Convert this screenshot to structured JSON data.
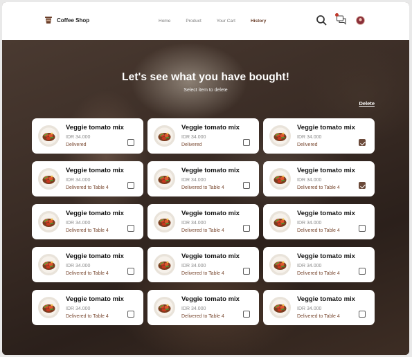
{
  "header": {
    "brand": "Coffee Shop",
    "nav": [
      {
        "label": "Home",
        "active": false
      },
      {
        "label": "Product",
        "active": false
      },
      {
        "label": "Your Cart",
        "active": false
      },
      {
        "label": "History",
        "active": true
      }
    ],
    "icons": [
      "search-icon",
      "chat-icon",
      "avatar"
    ]
  },
  "hero": {
    "title": "Let's see what you have bought!",
    "subtitle": "Select item to delete",
    "delete_label": "Delete"
  },
  "colors": {
    "accent": "#6b3f2a",
    "status_text": "#7a4a32",
    "checkbox_checked": "#6b4a3a"
  },
  "items": [
    {
      "name": "Veggie tomato mix",
      "price": "IDR 34.000",
      "status": "Delivered",
      "checked": false
    },
    {
      "name": "Veggie tomato mix",
      "price": "IDR 34.000",
      "status": "Delivered",
      "checked": false
    },
    {
      "name": "Veggie tomato mix",
      "price": "IDR 34.000",
      "status": "Delivered",
      "checked": true
    },
    {
      "name": "Veggie tomato mix",
      "price": "IDR 34.000",
      "status": "Delivered to Table 4",
      "checked": false
    },
    {
      "name": "Veggie tomato mix",
      "price": "IDR 34.000",
      "status": "Delivered to Table 4",
      "checked": false
    },
    {
      "name": "Veggie tomato mix",
      "price": "IDR 34.000",
      "status": "Delivered to Table 4",
      "checked": true
    },
    {
      "name": "Veggie tomato mix",
      "price": "IDR 34.000",
      "status": "Delivered to Table 4",
      "checked": false
    },
    {
      "name": "Veggie tomato mix",
      "price": "IDR 34.000",
      "status": "Delivered to Table 4",
      "checked": false
    },
    {
      "name": "Veggie tomato mix",
      "price": "IDR 34.000",
      "status": "Delivered to Table 4",
      "checked": false
    },
    {
      "name": "Veggie tomato mix",
      "price": "IDR 34.000",
      "status": "Delivered to Table 4",
      "checked": false
    },
    {
      "name": "Veggie tomato mix",
      "price": "IDR 34.000",
      "status": "Delivered to Table 4",
      "checked": false
    },
    {
      "name": "Veggie tomato mix",
      "price": "IDR 34.000",
      "status": "Delivered to Table 4",
      "checked": false
    },
    {
      "name": "Veggie tomato mix",
      "price": "IDR 34.000",
      "status": "Delivered to Table 4",
      "checked": false
    },
    {
      "name": "Veggie tomato mix",
      "price": "IDR 34.000",
      "status": "Delivered to Table 4",
      "checked": false
    },
    {
      "name": "Veggie tomato mix",
      "price": "IDR 34.000",
      "status": "Delivered to Table 4",
      "checked": false
    }
  ]
}
